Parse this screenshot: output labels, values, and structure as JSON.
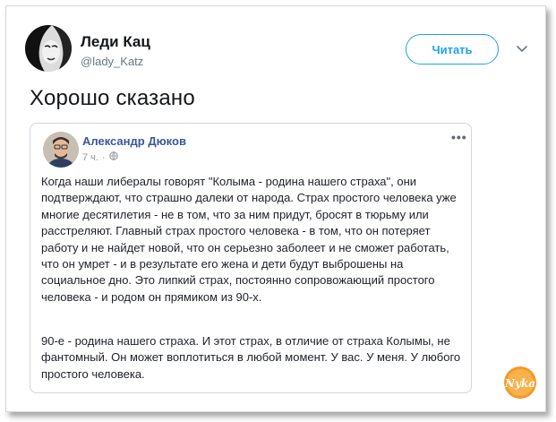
{
  "tweet": {
    "author_name": "Леди Кац",
    "author_handle": "@lady_Katz",
    "follow_label": "Читать",
    "text": "Хорошо сказано"
  },
  "embed": {
    "author_name": "Александр Дюков",
    "time": "7 ч.",
    "separator": "·",
    "paragraph_1": "Когда наши либералы говорят \"Колыма - родина нашего страха\", они подтверждают, что страшно далеки от народа. Страх простого человека уже многие десятилетия - не в том, что за ним придут, бросят в тюрьму или расстреляют. Главный страх простого человека - в том, что он потеряет работу и не найдет новой, что он серьезно заболеет и не сможет работать, что он умрет - и в результате его жена и дети будут выброшены на социальное дно. Это липкий страх, постоянно сопровожающий простого человека - и родом он прямиком из 90-х.",
    "paragraph_2": "90-е - родина нашего страха. И этот страх, в отличие от страха Колымы, не фантомный. Он может воплотиться в любой момент. У вас. У меня. У любого простого человека."
  },
  "watermark_text": "Nyka",
  "colors": {
    "twitter_blue": "#1da1f2",
    "fb_link": "#385898",
    "watermark": "#f39a2b"
  }
}
